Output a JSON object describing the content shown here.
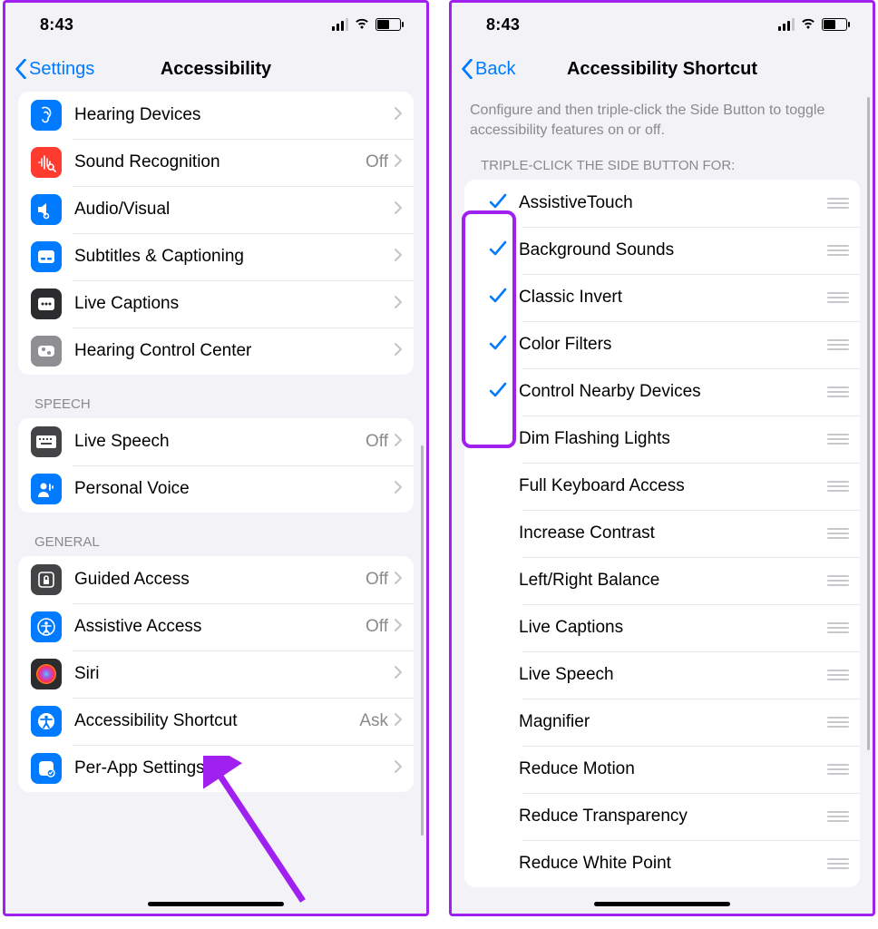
{
  "statusbar": {
    "time": "8:43"
  },
  "left": {
    "nav": {
      "back": "Settings",
      "title": "Accessibility"
    },
    "group1": [
      {
        "label": "Hearing Devices",
        "value": "",
        "icon": "ear-icon",
        "bg": "bg-blue"
      },
      {
        "label": "Sound Recognition",
        "value": "Off",
        "icon": "waveform-search-icon",
        "bg": "bg-red"
      },
      {
        "label": "Audio/Visual",
        "value": "",
        "icon": "audio-visual-icon",
        "bg": "bg-blue"
      },
      {
        "label": "Subtitles & Captioning",
        "value": "",
        "icon": "captions-icon",
        "bg": "bg-blue"
      },
      {
        "label": "Live Captions",
        "value": "",
        "icon": "live-captions-icon",
        "bg": "bg-dark"
      },
      {
        "label": "Hearing Control Center",
        "value": "",
        "icon": "sliders-icon",
        "bg": "bg-gray"
      }
    ],
    "section_speech": "SPEECH",
    "group2": [
      {
        "label": "Live Speech",
        "value": "Off",
        "icon": "keyboard-icon",
        "bg": "bg-darkgray"
      },
      {
        "label": "Personal Voice",
        "value": "",
        "icon": "person-voice-icon",
        "bg": "bg-blue"
      }
    ],
    "section_general": "GENERAL",
    "group3": [
      {
        "label": "Guided Access",
        "value": "Off",
        "icon": "lock-icon",
        "bg": "bg-darkgray"
      },
      {
        "label": "Assistive Access",
        "value": "Off",
        "icon": "assistive-access-icon",
        "bg": "bg-blue"
      },
      {
        "label": "Siri",
        "value": "",
        "icon": "siri-icon",
        "bg": "bg-dark"
      },
      {
        "label": "Accessibility Shortcut",
        "value": "Ask",
        "icon": "accessibility-icon",
        "bg": "bg-blue"
      },
      {
        "label": "Per-App Settings",
        "value": "",
        "icon": "per-app-icon",
        "bg": "bg-blue"
      }
    ]
  },
  "right": {
    "nav": {
      "back": "Back",
      "title": "Accessibility Shortcut"
    },
    "desc": "Configure and then triple-click the Side Button to toggle accessibility features on or off.",
    "header": "TRIPLE-CLICK THE SIDE BUTTON FOR:",
    "items": [
      {
        "label": "AssistiveTouch",
        "checked": true
      },
      {
        "label": "Background Sounds",
        "checked": true
      },
      {
        "label": "Classic Invert",
        "checked": true
      },
      {
        "label": "Color Filters",
        "checked": true
      },
      {
        "label": "Control Nearby Devices",
        "checked": true
      },
      {
        "label": "Dim Flashing Lights",
        "checked": false
      },
      {
        "label": "Full Keyboard Access",
        "checked": false
      },
      {
        "label": "Increase Contrast",
        "checked": false
      },
      {
        "label": "Left/Right Balance",
        "checked": false
      },
      {
        "label": "Live Captions",
        "checked": false
      },
      {
        "label": "Live Speech",
        "checked": false
      },
      {
        "label": "Magnifier",
        "checked": false
      },
      {
        "label": "Reduce Motion",
        "checked": false
      },
      {
        "label": "Reduce Transparency",
        "checked": false
      },
      {
        "label": "Reduce White Point",
        "checked": false
      }
    ]
  }
}
